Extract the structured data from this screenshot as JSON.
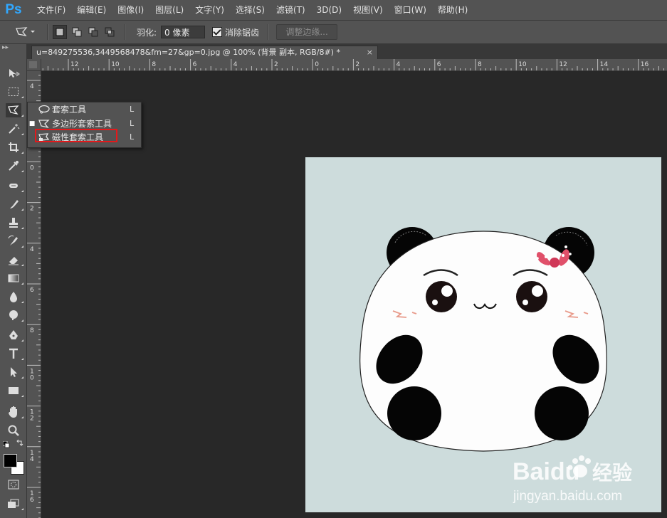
{
  "app": {
    "logo": "Ps",
    "accent": "#31a8ff"
  },
  "menu": [
    "文件(F)",
    "编辑(E)",
    "图像(I)",
    "图层(L)",
    "文字(Y)",
    "选择(S)",
    "滤镜(T)",
    "3D(D)",
    "视图(V)",
    "窗口(W)",
    "帮助(H)"
  ],
  "options": {
    "tool_icon": "polygonal-lasso-icon",
    "selection_modes": [
      "new-selection",
      "add-to-selection",
      "subtract-from-selection",
      "intersect-with-selection"
    ],
    "feather_label": "羽化:",
    "feather_value": "0 像素",
    "antialias_label": "消除锯齿",
    "antialias_checked": true,
    "refine_edge_label": "调整边缘..."
  },
  "document": {
    "tab_title": "u=849275536,3449568478&fm=27&gp=0.jpg @ 100% (背景 副本, RGB/8#) *",
    "close_glyph": "×"
  },
  "rulers": {
    "horizontal": [
      "12",
      "10",
      "8",
      "6",
      "4",
      "2",
      "0",
      "2",
      "4",
      "6",
      "8",
      "10",
      "12",
      "14",
      "16"
    ],
    "vertical": [
      "4",
      "2",
      "0",
      "2",
      "4",
      "6",
      "8",
      "1\n0",
      "1\n2",
      "1\n4",
      "1\n6"
    ]
  },
  "flyout": {
    "items": [
      {
        "label": "套索工具",
        "shortcut": "L",
        "selected": false,
        "icon": "lasso-icon"
      },
      {
        "label": "多边形套索工具",
        "shortcut": "L",
        "selected": true,
        "icon": "polygonal-lasso-icon"
      },
      {
        "label": "磁性套索工具",
        "shortcut": "L",
        "selected": false,
        "icon": "magnetic-lasso-icon",
        "highlighted": true
      }
    ],
    "highlight_color": "#e3191b"
  },
  "image": {
    "background_color": "#cddcdc",
    "subject": "panda"
  },
  "watermark": {
    "brand": "Baidu",
    "brand_cn": "经验",
    "url": "jingyan.baidu.com"
  },
  "toolbox": {
    "tools": [
      "move-icon",
      "marquee-icon",
      "lasso-icon",
      "magic-wand-icon",
      "crop-icon",
      "eyedropper-icon",
      "healing-brush-icon",
      "brush-icon",
      "clone-stamp-icon",
      "history-brush-icon",
      "eraser-icon",
      "gradient-icon",
      "blur-icon",
      "dodge-icon",
      "pen-icon",
      "type-icon",
      "path-selection-icon",
      "rectangle-icon",
      "hand-icon",
      "zoom-icon",
      "swap-colors-icon",
      "color-swatches-icon",
      "quick-mask-icon",
      "screen-mode-icon"
    ],
    "foreground_color": "#000000",
    "background_color": "#ffffff"
  }
}
